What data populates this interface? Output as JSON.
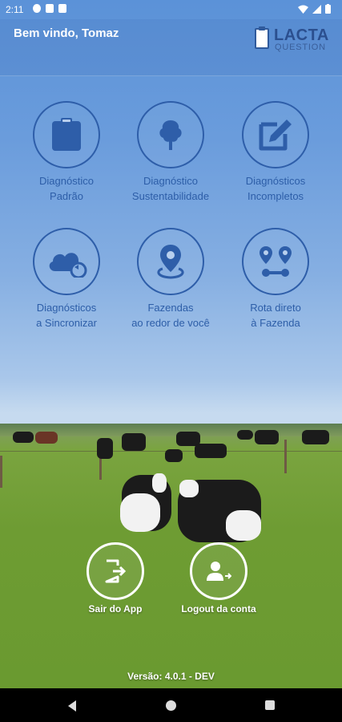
{
  "status_bar": {
    "time": "2:11"
  },
  "header": {
    "welcome": "Bem vindo, Tomaz",
    "logo_name": "LACTA",
    "logo_sub": "QUESTION"
  },
  "tiles": [
    {
      "line1": "Diagnóstico",
      "line2": "Padrão",
      "icon": "clipboard-icon"
    },
    {
      "line1": "Diagnóstico",
      "line2": "Sustentabilidade",
      "icon": "tree-icon"
    },
    {
      "line1": "Diagnósticos",
      "line2": "Incompletos",
      "icon": "edit-icon"
    },
    {
      "line1": "Diagnósticos",
      "line2": "a Sincronizar",
      "icon": "cloud-sync-icon"
    },
    {
      "line1": "Fazendas",
      "line2": "ao redor de você",
      "icon": "location-pin-icon"
    },
    {
      "line1": "Rota direto",
      "line2": "à Fazenda",
      "icon": "route-icon"
    }
  ],
  "actions": {
    "exit_label": "Sair do App",
    "logout_label": "Logout da conta"
  },
  "version": "Versão: 4.0.1 - DEV",
  "colors": {
    "accent": "#2e5ea9",
    "sky": "#6a9cdc",
    "grass": "#6e9c33"
  }
}
